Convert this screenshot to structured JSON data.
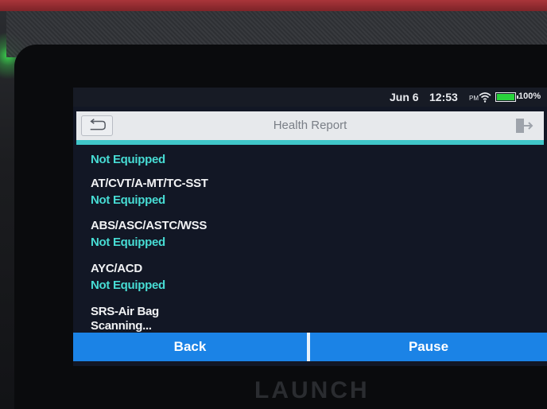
{
  "device": {
    "brand": "LAUNCH"
  },
  "status_bar": {
    "date": "Jun 6",
    "time": "12:53",
    "ampm": "PM",
    "battery_label": "100%",
    "battery_level": 1.0,
    "battery_color": "#29d33c",
    "icons": [
      "wifi-icon",
      "battery-icon"
    ]
  },
  "header": {
    "title": "Health Report",
    "left_icon": "return-arrow-icon",
    "right_icon": "exit-icon",
    "accent": "#40c6c9"
  },
  "report": {
    "first_status": "Not Equipped",
    "systems": [
      {
        "name": "AT/CVT/A-MT/TC-SST",
        "status": "Not Equipped"
      },
      {
        "name": "ABS/ASC/ASTC/WSS",
        "status": "Not Equipped"
      },
      {
        "name": "AYC/ACD",
        "status": "Not Equipped"
      },
      {
        "name": "SRS-Air Bag",
        "status": "Scanning..."
      }
    ],
    "status_color": "#47dcd4"
  },
  "buttons": {
    "back": "Back",
    "pause": "Pause",
    "color": "#1b83e6"
  }
}
